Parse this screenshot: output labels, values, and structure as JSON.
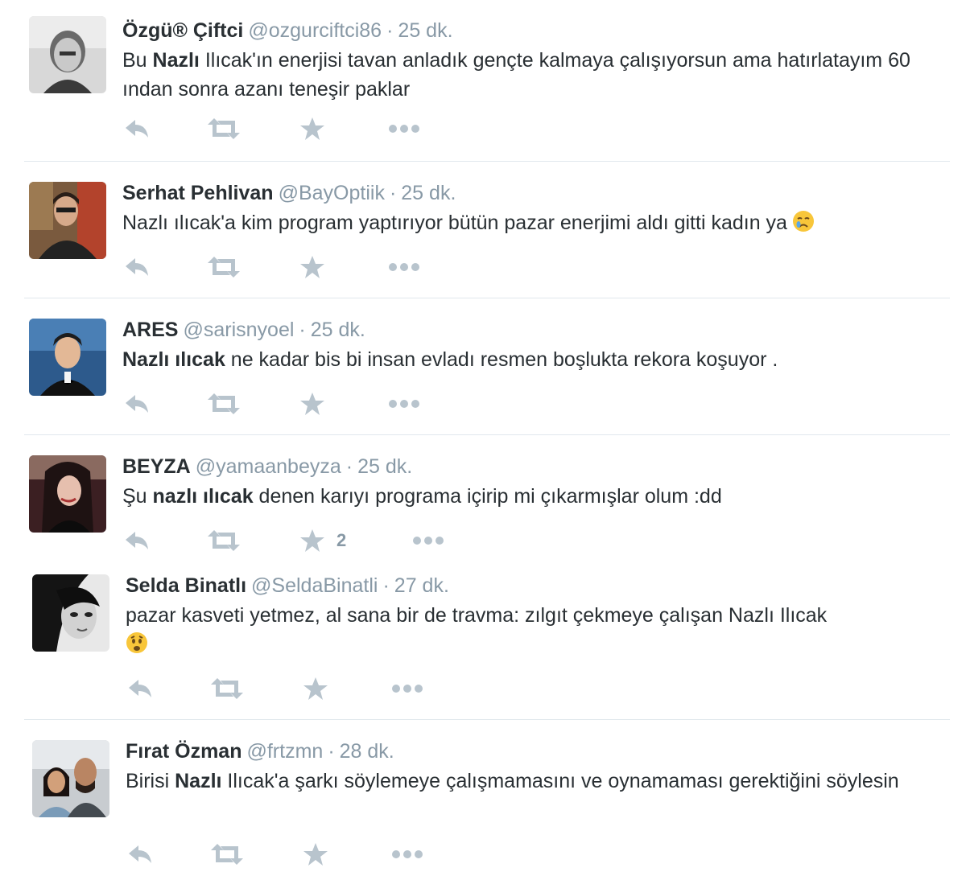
{
  "tweets": [
    {
      "fullname": "Özgü® Çiftci",
      "username": "@ozgurciftci86",
      "time": "25 dk.",
      "text_parts": [
        {
          "t": "Bu ",
          "b": false
        },
        {
          "t": "Nazlı",
          "b": true
        },
        {
          "t": " Ilıcak'ın enerjisi tavan anladık gençte kalmaya çalışıyorsun ama hatırlatayım 60 ından sonra azanı teneşir paklar",
          "b": false
        }
      ],
      "fav_count": ""
    },
    {
      "fullname": "Serhat Pehlivan",
      "username": "@BayOptiik",
      "time": "25 dk.",
      "text_parts": [
        {
          "t": "Nazlı ılıcak'a kim program yaptırıyor bütün pazar enerjimi aldı gitti kadın ya",
          "b": false
        }
      ],
      "emoji": "crying-face-emoji",
      "fav_count": ""
    },
    {
      "fullname": "ARES",
      "username": "@sarisnyoel",
      "time": "25 dk.",
      "text_parts": [
        {
          "t": "Nazlı ılıcak",
          "b": true
        },
        {
          "t": " ne kadar bis bi insan evladı resmen boşlukta rekora koşuyor .",
          "b": false
        }
      ],
      "fav_count": ""
    },
    {
      "fullname": "BEYZA",
      "username": "@yamaanbeyza",
      "time": "25 dk.",
      "text_parts": [
        {
          "t": "Şu ",
          "b": false
        },
        {
          "t": "nazlı ılıcak",
          "b": true
        },
        {
          "t": " denen karıyı programa içirip mi çıkarmışlar olum :dd",
          "b": false
        }
      ],
      "fav_count": "2"
    },
    {
      "fullname": "Selda Binatlı",
      "username": "@SeldaBinatli",
      "time": "27 dk.",
      "text_parts": [
        {
          "t": "pazar kasveti yetmez, al sana bir de travma: zılgıt çekmeye çalışan Nazlı Ilıcak",
          "b": false
        }
      ],
      "emoji": "worried-face-emoji",
      "fav_count": ""
    },
    {
      "fullname": "Fırat Özman",
      "username": "@frtzmn",
      "time": "28 dk.",
      "text_parts": [
        {
          "t": "Birisi ",
          "b": false
        },
        {
          "t": "Nazlı",
          "b": true
        },
        {
          "t": " Ilıcak'a şarkı söylemeye çalışmamasını ve oynamaması gerektiğini söylesin",
          "b": false
        }
      ],
      "fav_count": ""
    }
  ],
  "icons": {
    "reply": "reply-icon",
    "retweet": "retweet-icon",
    "favorite": "star-icon",
    "more": "more-dots-icon"
  },
  "colors": {
    "name": "#292f33",
    "meta": "#8899a6",
    "action_icon": "#b8c4cd",
    "divider": "#e1e8ed"
  }
}
